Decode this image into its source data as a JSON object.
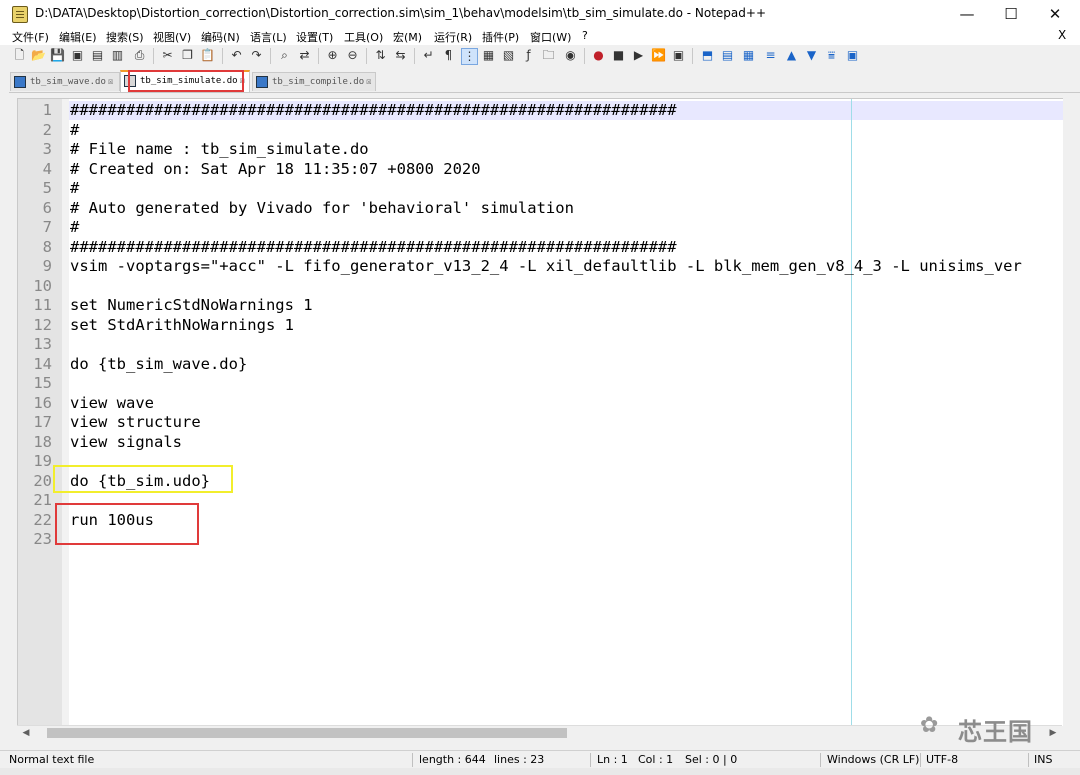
{
  "window": {
    "title": "D:\\DATA\\Desktop\\Distortion_correction\\Distortion_correction.sim\\sim_1\\behav\\modelsim\\tb_sim_simulate.do - Notepad++",
    "minimize": "—",
    "maximize": "☐",
    "close": "✕"
  },
  "menu": {
    "items": [
      "文件(F)",
      "编辑(E)",
      "搜索(S)",
      "视图(V)",
      "编码(N)",
      "语言(L)",
      "设置(T)",
      "工具(O)",
      "宏(M)",
      "运行(R)",
      "插件(P)",
      "窗口(W)",
      "?"
    ],
    "close": "X"
  },
  "tabs": [
    {
      "label": "tb_sim_wave.do",
      "close": "☒"
    },
    {
      "label": "tb_sim_simulate.do",
      "close": "☒"
    },
    {
      "label": "tb_sim_compile.do",
      "close": "☒"
    }
  ],
  "editor": {
    "lines": [
      {
        "n": "1",
        "text": "#################################################################"
      },
      {
        "n": "2",
        "text": "#"
      },
      {
        "n": "3",
        "text": "# File name : tb_sim_simulate.do"
      },
      {
        "n": "4",
        "text": "# Created on: Sat Apr 18 11:35:07 +0800 2020"
      },
      {
        "n": "5",
        "text": "#"
      },
      {
        "n": "6",
        "text": "# Auto generated by Vivado for 'behavioral' simulation"
      },
      {
        "n": "7",
        "text": "#"
      },
      {
        "n": "8",
        "text": "#################################################################"
      },
      {
        "n": "9",
        "text": "vsim -voptargs=\"+acc\" -L fifo_generator_v13_2_4 -L xil_defaultlib -L blk_mem_gen_v8_4_3 -L unisims_ver"
      },
      {
        "n": "10",
        "text": ""
      },
      {
        "n": "11",
        "text": "set NumericStdNoWarnings 1"
      },
      {
        "n": "12",
        "text": "set StdArithNoWarnings 1"
      },
      {
        "n": "13",
        "text": ""
      },
      {
        "n": "14",
        "text": "do {tb_sim_wave.do}"
      },
      {
        "n": "15",
        "text": ""
      },
      {
        "n": "16",
        "text": "view wave"
      },
      {
        "n": "17",
        "text": "view structure"
      },
      {
        "n": "18",
        "text": "view signals"
      },
      {
        "n": "19",
        "text": ""
      },
      {
        "n": "20",
        "text": "do {tb_sim.udo}"
      },
      {
        "n": "21",
        "text": ""
      },
      {
        "n": "22",
        "text": "run 100us"
      },
      {
        "n": "23",
        "text": ""
      }
    ]
  },
  "watermark": {
    "text": "芯王国"
  },
  "status": {
    "file_type": "Normal text file",
    "length": "length : 644",
    "lines": "lines : 23",
    "ln": "Ln : 1",
    "col": "Col : 1",
    "sel": "Sel : 0 | 0",
    "eol": "Windows (CR LF)",
    "encoding": "UTF-8",
    "mode": "INS"
  },
  "colors": {
    "annotation_red": "#e03a3a",
    "annotation_yellow": "#f2ee2c",
    "active_tab_accent": "#f19a28"
  }
}
